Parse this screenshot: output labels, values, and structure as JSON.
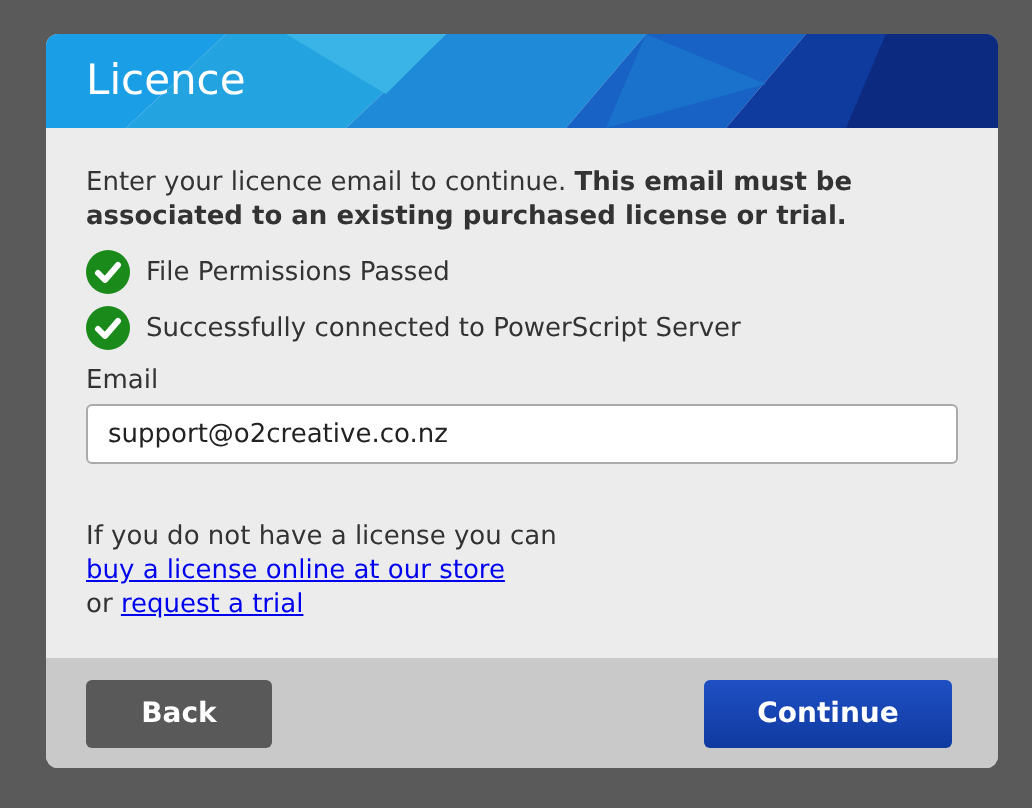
{
  "dialog": {
    "title": "Licence"
  },
  "intro": "Enter your licence email to continue. **This email must be associated to an existing purchased license or trial.**",
  "checks": [
    {
      "label": "File Permissions Passed",
      "passed": true
    },
    {
      "label": "Successfully connected to PowerScript Server",
      "passed": true
    }
  ],
  "email": {
    "label": "Email",
    "value": "support@o2creative.co.nz"
  },
  "note": {
    "text": "If you do not have a license you can",
    "link": "buy a license online at our store",
    "joiner": "or",
    "link_2": "request a trial"
  },
  "buttons": [
    {
      "label": "Back",
      "kind": "secondary"
    },
    {
      "label": "Continue",
      "kind": "primary"
    }
  ]
}
